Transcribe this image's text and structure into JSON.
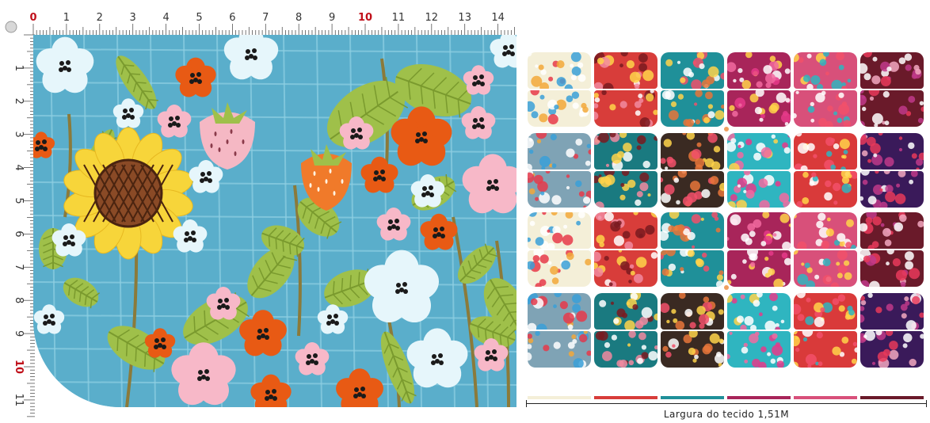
{
  "ruler": {
    "top_numbers": [
      "0",
      "1",
      "2",
      "3",
      "4",
      "5",
      "6",
      "7",
      "8",
      "9",
      "10",
      "11",
      "12",
      "13",
      "14"
    ],
    "left_numbers": [
      "1",
      "2",
      "3",
      "4",
      "5",
      "6",
      "7",
      "8",
      "9",
      "10",
      "11"
    ],
    "highlight_color": "#c0101a",
    "number_color": "#333333"
  },
  "swatch": {
    "background": "#5aaecb",
    "grid_color": "#8fd0e3",
    "colors": {
      "sunflower_petal": "#f7d53a",
      "sunflower_center": "#8a4a26",
      "leaf": "#9fc04a",
      "leaf_dark": "#7a9a2e",
      "stem": "#8b7a3a",
      "orange_flower": "#e85a14",
      "pink_flower": "#f7b8c8",
      "white_flower": "#e6f6fb",
      "strawberry_pink": "#f5b8c4",
      "strawberry_orange": "#f07a2a"
    }
  },
  "sheet": {
    "tile_colors": [
      [
        "#f4efd8",
        "#d83d3a",
        "#1f9099",
        "#a8255a",
        "#d8507a",
        "#6a1a2a"
      ],
      [
        "#f4efd8",
        "#d83d3a",
        "#1f9099",
        "#a8255a",
        "#d8507a",
        "#6a1a2a"
      ],
      [
        "#7fa3b5",
        "#1a7a80",
        "#3a2a22",
        "#2fb5c0",
        "#d93a3a",
        "#3a1a5a"
      ],
      [
        "#7fa3b5",
        "#1a7a80",
        "#3a2a22",
        "#2fb5c0",
        "#d93a3a",
        "#3a1a5a"
      ],
      [
        "#f4efd8",
        "#d83d3a",
        "#1f9099",
        "#a8255a",
        "#d8507a",
        "#6a1a2a"
      ],
      [
        "#f4efd8",
        "#d83d3a",
        "#1f9099",
        "#a8255a",
        "#d8507a",
        "#6a1a2a"
      ],
      [
        "#7fa3b5",
        "#1a7a80",
        "#3a2a22",
        "#2fb5c0",
        "#d93a3a",
        "#3a1a5a"
      ],
      [
        "#7fa3b5",
        "#1a7a80",
        "#3a2a22",
        "#2fb5c0",
        "#d93a3a",
        "#3a1a5a"
      ]
    ],
    "accent_colors": [
      [
        "#e63a4a",
        "#f2a83a",
        "#3aa0d8",
        "#ffffff"
      ],
      [
        "#ffd34a",
        "#ffffff",
        "#7a1a20",
        "#f28aa0"
      ],
      [
        "#f2506a",
        "#ffd34a",
        "#ffffff",
        "#e8753a"
      ],
      [
        "#f26aa0",
        "#ffffff",
        "#e63a8a",
        "#ffd34a"
      ],
      [
        "#ffffff",
        "#2fb5c0",
        "#f2506a",
        "#ffd34a"
      ],
      [
        "#e83a5a",
        "#f2a8c0",
        "#ffffff",
        "#c03a8a"
      ]
    ],
    "fabric_width_caption": "Largura do tecido 1,51M"
  }
}
